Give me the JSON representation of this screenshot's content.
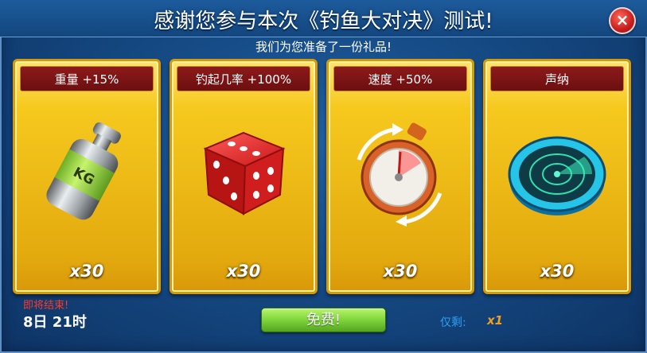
{
  "dialog": {
    "title": "感谢您参与本次《钓鱼大对决》测试!",
    "subtitle": "我们为您准备了一份礼品!",
    "close_icon": "close-icon"
  },
  "cards": [
    {
      "label": "重量 +15%",
      "quantity": "x30",
      "icon": "weight-icon"
    },
    {
      "label": "钓起几率 +100%",
      "quantity": "x30",
      "icon": "dice-icon"
    },
    {
      "label": "速度 +50%",
      "quantity": "x30",
      "icon": "stopwatch-icon"
    },
    {
      "label": "声纳",
      "quantity": "x30",
      "icon": "sonar-icon"
    }
  ],
  "footer": {
    "ending_label": "即将结束!",
    "time_left": "8日 21时",
    "free_button": "免费!",
    "remaining_label": "仅剩:",
    "remaining_value": "x1"
  },
  "colors": {
    "card_gold": "#f6c91e",
    "header_red": "#7a1414",
    "button_green": "#7fd43c",
    "alert_red": "#ff3a2a",
    "accent_blue": "#2e9df1",
    "accent_orange": "#f0a020"
  }
}
